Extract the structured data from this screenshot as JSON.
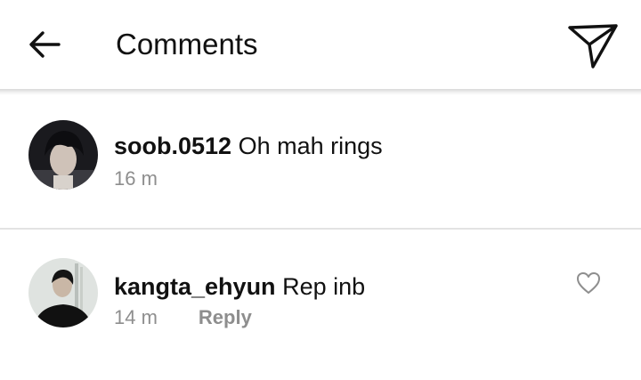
{
  "header": {
    "title": "Comments",
    "back_icon": "arrow-left-icon",
    "send_icon": "paper-plane-icon"
  },
  "comments": [
    {
      "username": "soob.0512",
      "text": "Oh mah rings",
      "time": "16 m",
      "avatar_icon": "user-avatar"
    },
    {
      "username": "kangta_ehyun",
      "text": "Rep inb",
      "time": "14 m",
      "reply_label": "Reply",
      "like_icon": "heart-outline-icon",
      "avatar_icon": "user-avatar"
    }
  ],
  "colors": {
    "text": "#111111",
    "meta": "#8e8e8e",
    "divider": "#e3e3e3"
  }
}
